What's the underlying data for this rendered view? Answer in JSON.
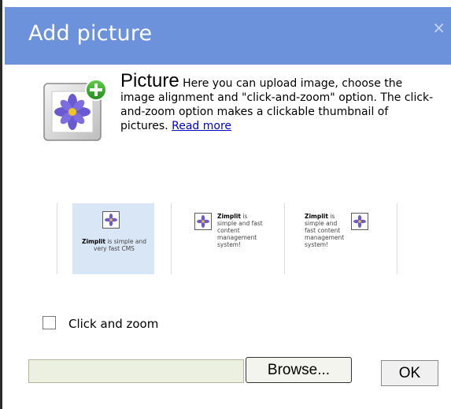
{
  "dialog": {
    "title": "Add picture",
    "close_glyph": "×",
    "heading": "Picture",
    "description": "Here you can upload image, choose the image alignment and \"click-and-zoom\" option. The click-and-zoom option makes a clickable thumbnail of pictures.",
    "read_more": "Read more"
  },
  "alignment_options": [
    {
      "id": "center",
      "brand": "Zimplit",
      "text": "is simple and very fast CMS",
      "selected": true
    },
    {
      "id": "left",
      "brand": "Zimplit",
      "text": "is simple and fast content management system!",
      "selected": false
    },
    {
      "id": "right",
      "brand": "Zimplit",
      "text": "is simple and fast content management system!",
      "selected": false
    }
  ],
  "click_and_zoom": {
    "label": "Click and zoom",
    "checked": false
  },
  "upload": {
    "file_value": "",
    "browse_label": "Browse...",
    "ok_label": "OK"
  },
  "colors": {
    "titlebar": "#6c92dc",
    "selected_option": "#d9e6f5",
    "link": "#0000cc"
  },
  "icons": [
    "close-icon",
    "add-picture-icon",
    "flower-thumbnail-icon",
    "checkbox"
  ]
}
